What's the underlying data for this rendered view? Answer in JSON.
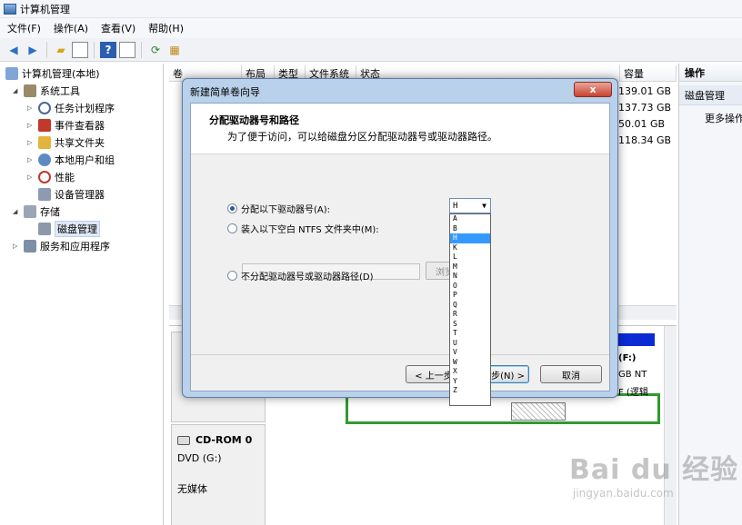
{
  "window": {
    "title": "计算机管理"
  },
  "menu": [
    "文件(F)",
    "操作(A)",
    "查看(V)",
    "帮助(H)"
  ],
  "toolbar": [
    "back-arrow-icon",
    "forward-arrow-icon",
    "up-folder-icon",
    "show-tree-icon",
    "help-icon",
    "properties-icon",
    "refresh-icon",
    "export-icon"
  ],
  "tree": {
    "root": "计算机管理(本地)",
    "system_tools": "系统工具",
    "task_scheduler": "任务计划程序",
    "event_viewer": "事件查看器",
    "shared_folders": "共享文件夹",
    "local_users": "本地用户和组",
    "performance": "性能",
    "device_manager": "设备管理器",
    "storage": "存储",
    "disk_management": "磁盘管理",
    "services_apps": "服务和应用程序"
  },
  "volume_table": {
    "columns": [
      "卷",
      "布局",
      "类型",
      "文件系统",
      "状态"
    ],
    "capacity_header": "容量",
    "capacities": [
      "139.01 GB",
      "137.73 GB",
      "50.01 GB",
      "118.34 GB"
    ]
  },
  "actions": {
    "header": "操作",
    "selected": "磁盘管理",
    "more": "更多操作"
  },
  "disk_panel": {
    "partition_right": {
      "label": "(F:)",
      "size": "GB NT",
      "status": "F (逻辑"
    },
    "cdrom": {
      "name": "CD-ROM 0",
      "type": "DVD (G:)",
      "status": "无媒体"
    }
  },
  "dialog": {
    "title": "新建简单卷向导",
    "close_label": "x",
    "heading": "分配驱动器号和路径",
    "subheading": "为了便于访问，可以给磁盘分区分配驱动器号或驱动器路径。",
    "option_assign": "分配以下驱动器号(A):",
    "option_mount": "装入以下空白 NTFS 文件夹中(M):",
    "browse_label": "浏览",
    "option_none": "不分配驱动器号或驱动器路径(D)",
    "back_button": "< 上一步",
    "next_button": "步(N) >",
    "cancel_button": "取消"
  },
  "drive_select": {
    "selected": "H",
    "options": [
      "A",
      "B",
      "H",
      "K",
      "L",
      "M",
      "N",
      "O",
      "P",
      "Q",
      "R",
      "S",
      "T",
      "U",
      "V",
      "W",
      "X",
      "Y",
      "Z"
    ]
  },
  "watermark": {
    "brand": "Bai du 经验",
    "url": "jingyan.baidu.com"
  }
}
